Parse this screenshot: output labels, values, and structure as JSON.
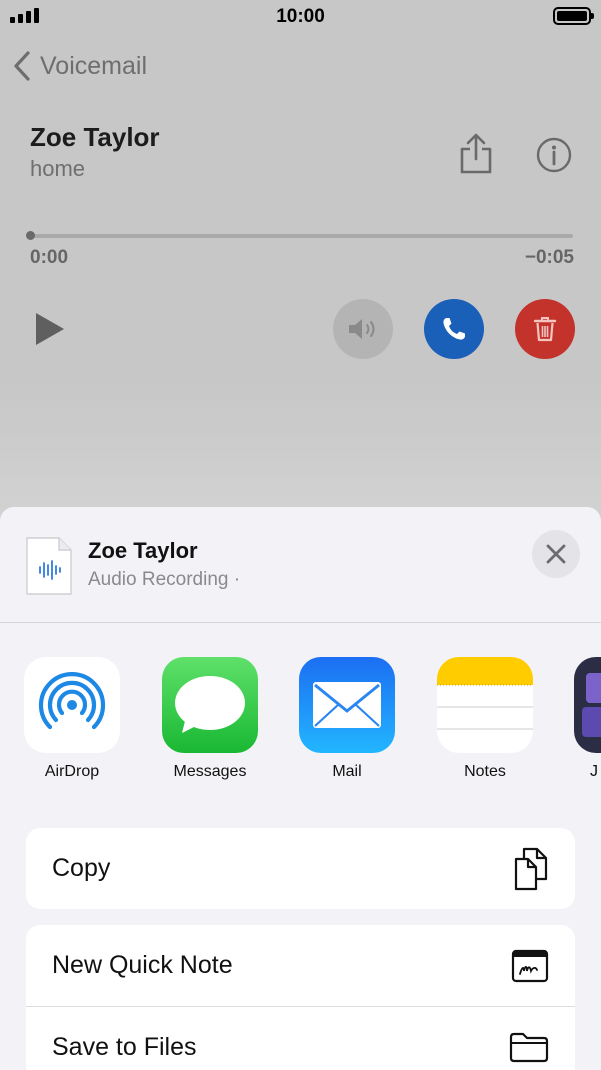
{
  "status_bar": {
    "time": "10:00"
  },
  "nav": {
    "back_label": "Voicemail"
  },
  "voicemail": {
    "name": "Zoe Taylor",
    "label": "home",
    "time_elapsed": "0:00",
    "time_remaining": "−0:05",
    "progress": 0.0
  },
  "share_sheet": {
    "title": "Zoe Taylor",
    "subtitle": "Audio Recording ·",
    "apps": [
      {
        "label": "AirDrop",
        "icon": "airdrop-icon"
      },
      {
        "label": "Messages",
        "icon": "messages-icon"
      },
      {
        "label": "Mail",
        "icon": "mail-icon"
      },
      {
        "label": "Notes",
        "icon": "notes-icon"
      },
      {
        "label": "J",
        "icon": "app-icon"
      }
    ],
    "actions": [
      {
        "label": "Copy",
        "icon": "copy-icon"
      },
      {
        "label": "New Quick Note",
        "icon": "quick-note-icon"
      },
      {
        "label": "Save to Files",
        "icon": "folder-icon"
      }
    ]
  },
  "colors": {
    "call": "#1a5fb8",
    "delete": "#c3332b",
    "messages_green": "#34c759",
    "mail_blue": "#1a8cff",
    "airdrop_blue": "#1e88e5",
    "notes_yellow": "#ffcc00"
  }
}
